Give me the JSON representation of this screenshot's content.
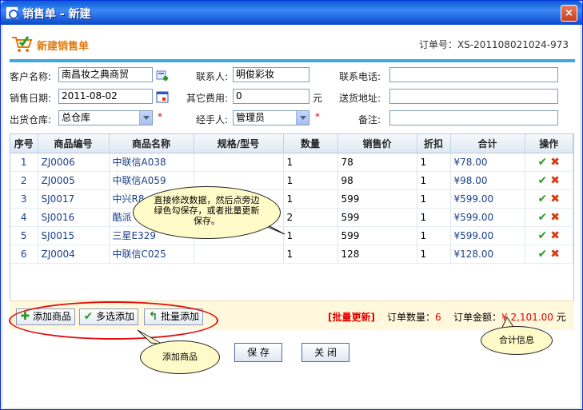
{
  "window": {
    "title": "销售单 - 新建",
    "close_label": "×"
  },
  "header": {
    "title": "新建销售单",
    "order_no_label": "订单号：",
    "order_no": "XS-201108021024-973"
  },
  "form": {
    "customer_label": "客户名称:",
    "customer_value": "南昌妆之典商贸",
    "contact_label": "联系人:",
    "contact_value": "明俊彩妆",
    "phone_label": "联系电话:",
    "phone_value": "",
    "date_label": "销售日期:",
    "date_value": "2011-08-02",
    "fee_label": "其它费用:",
    "fee_value": "0",
    "fee_unit": "元",
    "address_label": "送货地址:",
    "address_value": "",
    "warehouse_label": "出货仓库:",
    "warehouse_value": "总仓库",
    "handler_label": "经手人:",
    "handler_value": "管理员",
    "remark_label": "备注:",
    "remark_value": "",
    "required_mark": "*"
  },
  "grid": {
    "columns": [
      "序号",
      "商品编号",
      "商品名称",
      "规格/型号",
      "数量",
      "销售价",
      "折扣",
      "合计",
      "操作"
    ],
    "rows": [
      {
        "no": "1",
        "code": "ZJ0006",
        "name": "中联信A038",
        "spec": "",
        "qty": "1",
        "price": "78",
        "discount": "1",
        "total": "¥78.00"
      },
      {
        "no": "2",
        "code": "ZJ0005",
        "name": "中联信A059",
        "spec": "",
        "qty": "1",
        "price": "98",
        "discount": "1",
        "total": "¥98.00"
      },
      {
        "no": "3",
        "code": "SJ0017",
        "name": "中兴R8",
        "spec": "",
        "qty": "1",
        "price": "599",
        "discount": "1",
        "total": "¥599.00"
      },
      {
        "no": "4",
        "code": "SJ0016",
        "name": "酷派",
        "spec": "",
        "qty": "2",
        "price": "599",
        "discount": "1",
        "total": "¥599.00"
      },
      {
        "no": "5",
        "code": "SJ0015",
        "name": "三星E329",
        "spec": "",
        "qty": "1",
        "price": "599",
        "discount": "1",
        "total": "¥599.00"
      },
      {
        "no": "6",
        "code": "ZJ0004",
        "name": "中联信C025",
        "spec": "",
        "qty": "1",
        "price": "128",
        "discount": "1",
        "total": "¥128.00"
      }
    ]
  },
  "toolbar": {
    "add_label": "添加商品",
    "multi_add_label": "多选添加",
    "batch_add_label": "批量添加"
  },
  "summary": {
    "batch_update": "[批量更新]",
    "order_count_label": "订单数量：",
    "order_count": "6",
    "order_amount_label": "订单金额：",
    "order_amount": "¥ 2,101.00",
    "unit": "元"
  },
  "actions": {
    "save_label": "保 存",
    "close_label": "关 闭"
  },
  "callouts": {
    "edit_tip": "直接修改数据，然后点旁边绿色勾保存，或者批量更新保存。",
    "add_tip": "添加商品",
    "total_tip": "合计信息"
  },
  "colors": {
    "accent": "#3fa9e0",
    "title_orange": "#e07a10",
    "required": "#e00000"
  }
}
